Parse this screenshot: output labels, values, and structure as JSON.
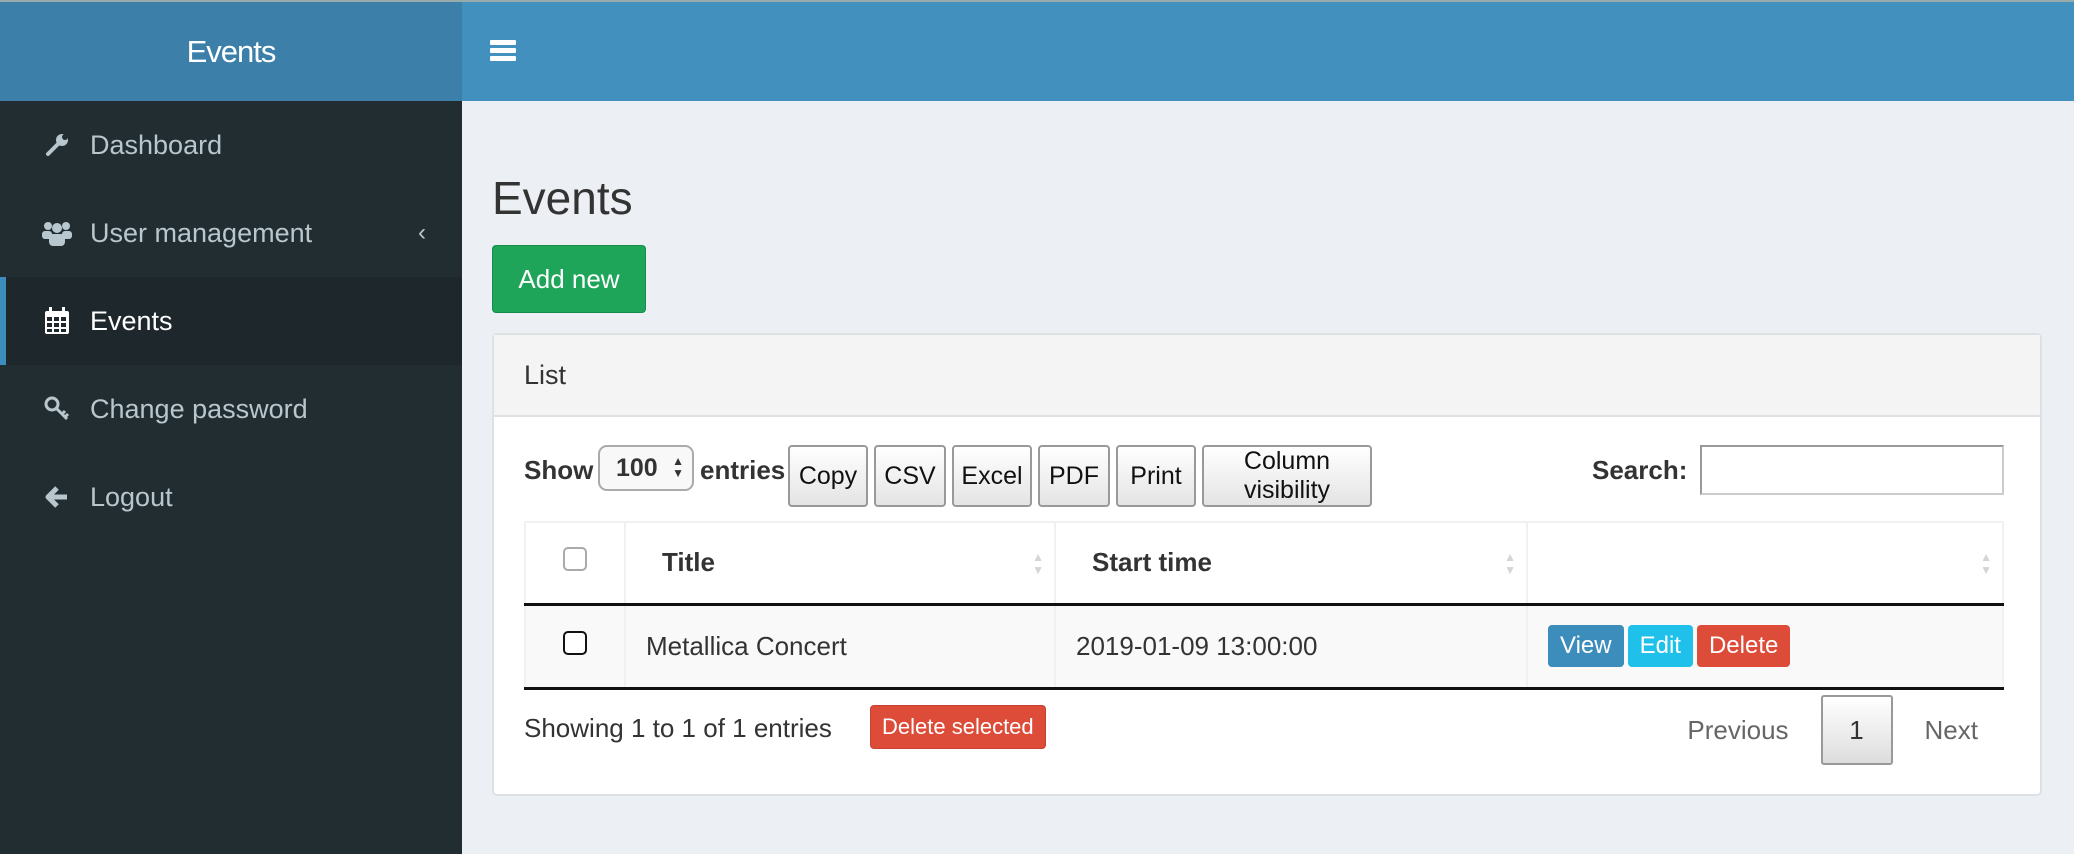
{
  "app": {
    "brand": "Events"
  },
  "sidebar": {
    "items": [
      {
        "label": "Dashboard",
        "icon": "wrench-icon"
      },
      {
        "label": "User management",
        "icon": "users-icon",
        "has_submenu": true
      },
      {
        "label": "Events",
        "icon": "calendar-icon",
        "active": true
      },
      {
        "label": "Change password",
        "icon": "key-icon"
      },
      {
        "label": "Logout",
        "icon": "arrow-left-icon"
      }
    ]
  },
  "page": {
    "title": "Events",
    "add_button": "Add new"
  },
  "panel": {
    "heading": "List",
    "toolbar": {
      "show_label": "Show",
      "page_length": "100",
      "entries_label": "entries",
      "buttons": [
        "Copy",
        "CSV",
        "Excel",
        "PDF",
        "Print",
        "Column visibility"
      ],
      "search_label": "Search:",
      "search_value": ""
    },
    "table": {
      "columns": [
        "",
        "Title",
        "Start time",
        ""
      ],
      "rows": [
        {
          "title": "Metallica Concert",
          "start_time": "2019-01-09 13:00:00",
          "actions": [
            "View",
            "Edit",
            "Delete"
          ]
        }
      ]
    },
    "footer": {
      "info": "Showing 1 to 1 of 1 entries",
      "delete_selected": "Delete selected",
      "pagination": {
        "previous": "Previous",
        "current": "1",
        "next": "Next"
      }
    }
  },
  "colors": {
    "header": "#4190bd",
    "brand": "#3c80aa",
    "sidebar": "#222d32",
    "success": "#1fa55a",
    "primary": "#3c8dbc",
    "info": "#1fc0ea",
    "danger": "#dd4b39"
  }
}
